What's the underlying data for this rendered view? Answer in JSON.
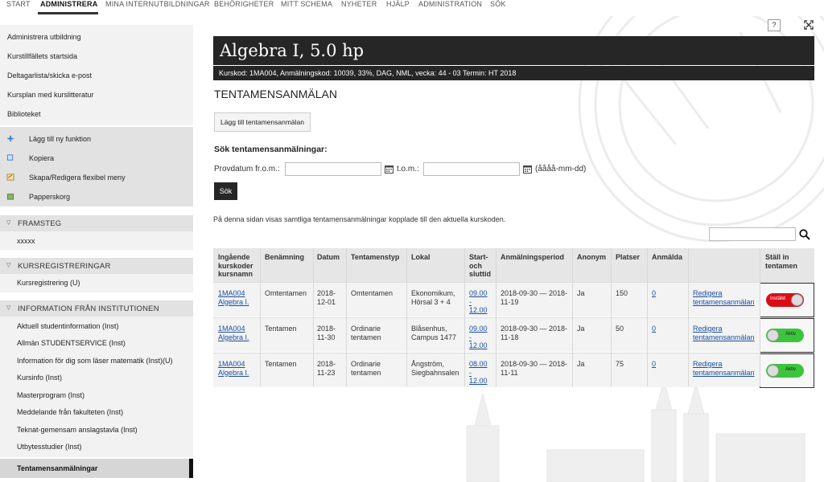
{
  "topnav": [
    "START",
    "ADMINISTRERA",
    "MINA INTERNUTBILDNINGAR",
    "BEHÖRIGHETER",
    "MITT SCHEMA",
    "NYHETER",
    "HJÄLP",
    "ADMINISTRATION",
    "SÖK"
  ],
  "topnav_active": "ADMINISTRERA",
  "help_button": "?",
  "sidebar": {
    "links": [
      "Administrera utbildning",
      "Kurstillfällets startsida",
      "Deltagarlista/skicka e-post",
      "Kursplan med kurslitteratur",
      "Biblioteket"
    ],
    "tools": [
      {
        "label": "Lägg till ny funktion",
        "icon": "plus-icon"
      },
      {
        "label": "Kopiera",
        "icon": "copy-icon"
      },
      {
        "label": "Skapa/Redigera flexibel meny",
        "icon": "edit-menu-icon"
      },
      {
        "label": "Papperskorg",
        "icon": "trash-icon"
      }
    ],
    "framsteg": {
      "title": "FRAMSTEG",
      "items": [
        "xxxxx"
      ]
    },
    "kursreg": {
      "title": "KURSREGISTRERINGAR",
      "items": [
        "Kursregistrering (U)"
      ]
    },
    "info": {
      "title": "INFORMATION FRÅN INSTITUTIONEN",
      "items": [
        "Aktuell studentinformation (Inst)",
        "Allmän STUDENTSERVICE (Inst)",
        "Information för dig som läser matematik (Inst)(U)",
        "Kursinfo (Inst)",
        "Masterprogram (Inst)",
        "Meddelande från fakulteten (Inst)",
        "Teknat-gemensam anslagstavla (Inst)",
        "Utbytesstudier (Inst)"
      ]
    },
    "active_item": "Tentamensanmälningar"
  },
  "course": {
    "title": "Algebra I, 5.0 hp",
    "info": "Kurskod: 1MA004, Anmälningskod: 10039, 33%, DAG, NML, vecka: 44 - 03 Termin: HT 2018"
  },
  "page": {
    "heading": "TENTAMENSANMÄLAN",
    "add_button": "Lägg till tentamensanmälan",
    "search_heading": "Sök tentamensanmälningar:",
    "from_label": "Provdatum fr.o.m.:",
    "to_label": "t.o.m.:",
    "date_format": "(åååå-mm-dd)",
    "search_button": "Sök",
    "description": "På denna sidan visas samtliga tentamensanmälningar kopplade till den aktuella kurskoden."
  },
  "table": {
    "headers": [
      "Ingående kurskoder kursnamn",
      "Benämning",
      "Datum",
      "Tentamenstyp",
      "Lokal",
      "Start- och sluttid",
      "Anmälningsperiod",
      "Anonym",
      "Platser",
      "Anmälda",
      "",
      "Ställ in tentamen"
    ],
    "rows": [
      {
        "code": "1MA004",
        "name": "Algebra I.",
        "benamning": "Omtentamen",
        "datum": "2018-12-01",
        "typ": "Omtentamen",
        "lokal": "Ekonomikum, Hörsal 3 + 4",
        "start": "09.00",
        "slut": "12.00",
        "period": "2018-09-30 — 2018-11-19",
        "anonym": "Ja",
        "platser": "150",
        "anmalda": "0",
        "edit": "Redigera tentamensanmälan",
        "toggle": "Inställd",
        "active": false
      },
      {
        "code": "1MA004",
        "name": "Algebra I.",
        "benamning": "Tentamen",
        "datum": "2018-11-30",
        "typ": "Ordinarie tentamen",
        "lokal": "Blåsenhus, Campus 1477",
        "start": "09.00",
        "slut": "12.00",
        "period": "2018-09-30 — 2018-11-18",
        "anonym": "Ja",
        "platser": "50",
        "anmalda": "0",
        "edit": "Redigera tentamensanmälan",
        "toggle": "Aktiv",
        "active": true
      },
      {
        "code": "1MA004",
        "name": "Algebra I.",
        "benamning": "Tentamen",
        "datum": "2018-11-23",
        "typ": "Ordinarie tentamen",
        "lokal": "Ångström, Siegbahnsalen",
        "start": "08.00",
        "slut": "12.00",
        "period": "2018-09-30 — 2018-11-11",
        "anonym": "Ja",
        "platser": "75",
        "anmalda": "0",
        "edit": "Redigera tentamensanmälan",
        "toggle": "Aktiv",
        "active": true
      }
    ]
  },
  "colors": {
    "dark": "#262626",
    "link": "#1a4fa0",
    "toggle_on": "#3cc43c",
    "toggle_off": "#d90f17"
  }
}
